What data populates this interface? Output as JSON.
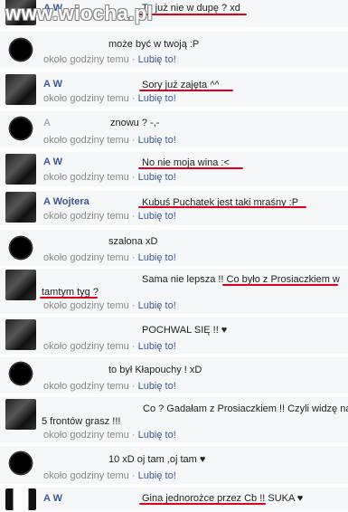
{
  "watermark": "www.wiocha.pl",
  "like_label": "Lubię to!",
  "time_label": "około godziny temu",
  "dot": "·",
  "comments": [
    {
      "name": "A          W",
      "text": "To już nie w dupę ? xd"
    },
    {
      "name": "",
      "text": "może być w twoją :P"
    },
    {
      "name": "A          W",
      "text": "Sory już zajęta ^^"
    },
    {
      "name": "A",
      "text": "znowu ? -,-"
    },
    {
      "name": "A          W",
      "text": "No nie moja wina :<"
    },
    {
      "name": "A         Wojtera",
      "text": "Kubuś Puchatek jest taki mraśny :P"
    },
    {
      "name": "",
      "text": "szalona xD"
    },
    {
      "name": "",
      "text": "Sama nie lepsza !! Co było z Prosiaczkiem w",
      "text2": "tamtym tyg ?"
    },
    {
      "name": "",
      "text": "POCHWAL SIĘ !! ♥"
    },
    {
      "name": "",
      "text": "to był Kłapouchy ! xD"
    },
    {
      "name": "",
      "text": "Co ? Gadałam z Prosiaczkiem !! Czyli widzę na",
      "text2": "5 frontów grasz !!!"
    },
    {
      "name": "",
      "text": "10 xD oj tam ,oj tam ♥"
    },
    {
      "name": "A          W",
      "text": "Gina jednorożce przez Cb !! SUKA ♥"
    }
  ]
}
